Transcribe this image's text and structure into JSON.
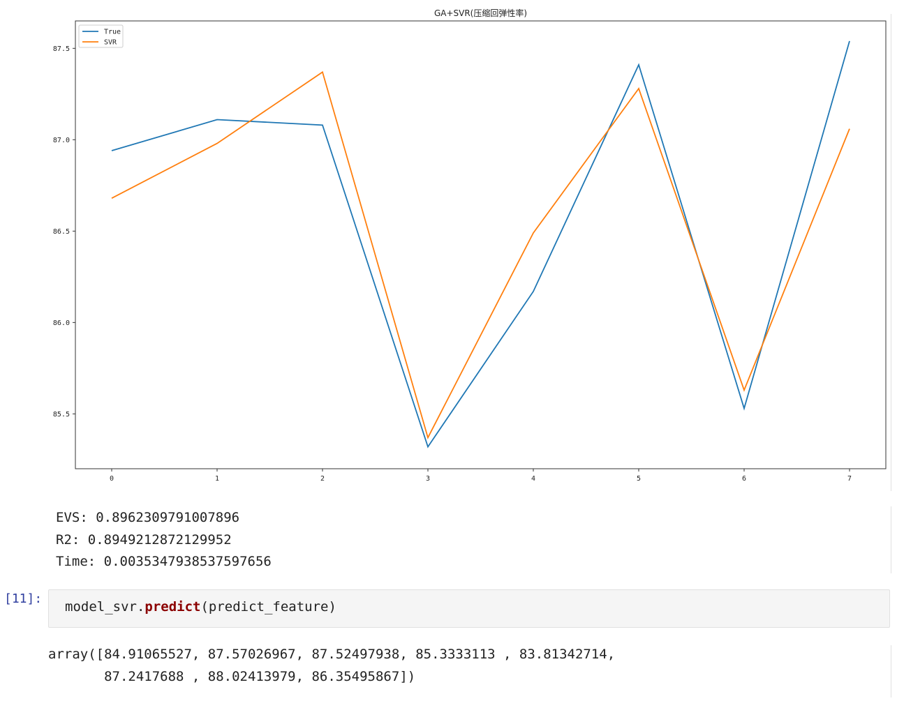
{
  "chart_data": {
    "type": "line",
    "title": "GA+SVR(压缩回弹性率)",
    "x": [
      0,
      1,
      2,
      3,
      4,
      5,
      6,
      7
    ],
    "xticks": [
      "0",
      "1",
      "2",
      "3",
      "4",
      "5",
      "6",
      "7"
    ],
    "ylim": [
      85.2,
      87.65
    ],
    "yticks": [
      85.5,
      86.0,
      86.5,
      87.0,
      87.5
    ],
    "ytick_labels": [
      "85.5",
      "86.0",
      "86.5",
      "87.0",
      "87.5"
    ],
    "legend_position": "upper-left",
    "grid": false,
    "series": [
      {
        "name": "True",
        "color": "#1f77b4",
        "values": [
          86.94,
          87.11,
          87.08,
          85.32,
          86.17,
          87.41,
          85.53,
          87.54
        ]
      },
      {
        "name": "SVR",
        "color": "#ff7f0e",
        "values": [
          86.68,
          86.98,
          87.37,
          85.37,
          86.49,
          87.28,
          85.63,
          87.06
        ]
      }
    ]
  },
  "output": {
    "evs": "EVS: 0.8962309791007896",
    "r2": "R2: 0.8949212872129952",
    "time": "Time: 0.0035347938537597656"
  },
  "cell": {
    "prompt": "[11]:",
    "code_obj": "model_svr.",
    "code_fn": "predict",
    "code_args": "(predict_feature)"
  },
  "result": {
    "line1": "array([84.91065527, 87.57026967, 87.52497938, 85.3333113 , 83.81342714,",
    "line2": "       87.2417688 , 88.02413979, 86.35495867])"
  }
}
